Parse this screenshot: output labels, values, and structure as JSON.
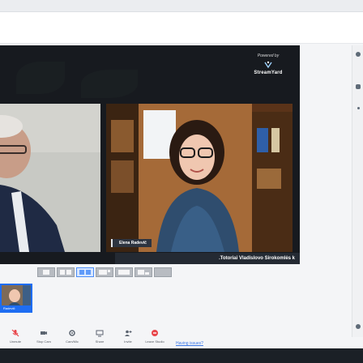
{
  "branding": {
    "powered_by": "Powered by",
    "name": "StreamYard"
  },
  "guests": [
    {
      "id": "left",
      "name": ""
    },
    {
      "id": "right",
      "name": "Elena Radevič"
    }
  ],
  "banner": {
    "text": ".Totoriai Vladislovo Sirokomlės k"
  },
  "layouts": {
    "count": 7,
    "active_index": 2
  },
  "self_view": {
    "label": "Radevič"
  },
  "toolbar": {
    "items": [
      {
        "label": "Unmute",
        "icon": "mic-off-icon",
        "color": "#e8454a"
      },
      {
        "label": "Stop Cam",
        "icon": "camera-icon",
        "color": "#5b6470"
      },
      {
        "label": "Cam/Mic",
        "icon": "gear-icon",
        "color": "#5b6470"
      },
      {
        "label": "Share",
        "icon": "screen-share-icon",
        "color": "#5b6470"
      },
      {
        "label": "Invite",
        "icon": "add-person-icon",
        "color": "#5b6470"
      },
      {
        "label": "Leave Studio",
        "icon": "leave-icon",
        "color": "#e8454a"
      }
    ],
    "help_text": "Having issues?"
  },
  "colors": {
    "stage_bg": "#171a1f",
    "accent_blue": "#1e6df2",
    "danger_red": "#e8454a"
  }
}
